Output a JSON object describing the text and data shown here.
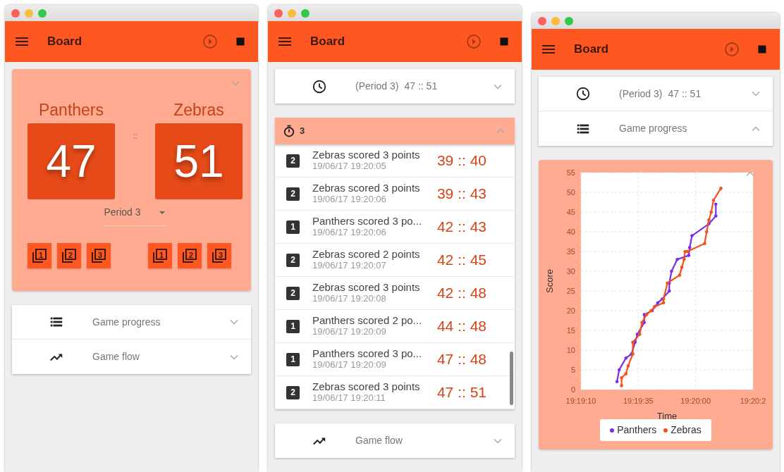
{
  "windows": [
    {
      "toolbar": {
        "title": "Board"
      },
      "blocks": [
        {
          "kind": "scoreboard",
          "expanded": false,
          "separator": "::",
          "period": "Period 3",
          "teams": [
            {
              "name": "Panthers",
              "score": "47",
              "buttons": [
                "1",
                "2",
                "3"
              ]
            },
            {
              "name": "Zebras",
              "score": "51",
              "buttons": [
                "1",
                "2",
                "3"
              ]
            }
          ]
        },
        {
          "kind": "accordion",
          "rows": [
            {
              "kind": "list",
              "label": "Game progress",
              "expanded": false
            },
            {
              "kind": "trend",
              "label": "Game flow",
              "expanded": false
            }
          ]
        }
      ]
    },
    {
      "toolbar": {
        "title": "Board"
      },
      "blocks": [
        {
          "kind": "accordion",
          "rows": [
            {
              "kind": "clock",
              "label": "(Period 3)",
              "score": "47 :: 51",
              "expanded": false
            }
          ]
        },
        {
          "kind": "log",
          "header": "3",
          "expanded": true,
          "entries": [
            {
              "badge": "2",
              "text": "Zebras scored 3 points",
              "time": "19/06/17 19:20:05",
              "score": "39 :: 40"
            },
            {
              "badge": "2",
              "text": "Zebras scored 3 points",
              "time": "19/06/17 19:20:06",
              "score": "39 :: 43"
            },
            {
              "badge": "1",
              "text": "Panthers scored 3 po...",
              "time": "19/06/17 19:20:06",
              "score": "42 :: 43"
            },
            {
              "badge": "2",
              "text": "Zebras scored 2 points",
              "time": "19/06/17 19:20:07",
              "score": "42 :: 45"
            },
            {
              "badge": "2",
              "text": "Zebras scored 3 points",
              "time": "19/06/17 19:20:08",
              "score": "42 :: 48"
            },
            {
              "badge": "1",
              "text": "Panthers scored 2 po...",
              "time": "19/06/17 19:20:09",
              "score": "44 :: 48"
            },
            {
              "badge": "1",
              "text": "Panthers scored 3 po...",
              "time": "19/06/17 19:20:09",
              "score": "47 :: 48"
            },
            {
              "badge": "2",
              "text": "Zebras scored 3 points",
              "time": "19/06/17 19:20:11",
              "score": "47 :: 51"
            }
          ]
        },
        {
          "kind": "accordion",
          "rows": [
            {
              "kind": "trend",
              "label": "Game flow",
              "expanded": false
            }
          ]
        }
      ]
    },
    {
      "toolbar": {
        "title": "Board"
      },
      "blocks": [
        {
          "kind": "accordion",
          "rows": [
            {
              "kind": "clock",
              "label": "(Period 3)",
              "score": "47 :: 51",
              "expanded": false
            },
            {
              "kind": "list",
              "label": "Game progress",
              "expanded": true
            }
          ]
        },
        {
          "kind": "chart",
          "expanded": true,
          "chart_data": {
            "type": "line",
            "grid": true,
            "xlabel": "Time",
            "ylabel": "Score",
            "xlim": [
              69550,
              69625
            ],
            "ylim": [
              0,
              55
            ],
            "xticks": [
              {
                "value": 69550,
                "label": "19:19:10"
              },
              {
                "value": 69575,
                "label": "19:19:35"
              },
              {
                "value": 69600,
                "label": "19:20:00"
              },
              {
                "value": 69625,
                "label": "19:20:2"
              }
            ],
            "yticks": [
              0,
              5,
              10,
              15,
              20,
              25,
              30,
              35,
              40,
              45,
              50,
              55
            ],
            "series": [
              {
                "name": "Panthers",
                "color": "#7b2ee6",
                "x": [
                  69565.7,
                  69566.7,
                  69569.6,
                  69572,
                  69573.6,
                  69574.6,
                  69577.6,
                  69577.6,
                  69581,
                  69583.5,
                  69585.5,
                  69588.5,
                  69588.5,
                  69589.5,
                  69592,
                  69597,
                  69597.4,
                  69598.4,
                  69605.8,
                  69608.8,
                  69608.8
                ],
                "values": [
                  2,
                  5,
                  8,
                  9,
                  12,
                  14,
                  17,
                  19,
                  20,
                  22,
                  23,
                  25,
                  27,
                  30,
                  33,
                  34,
                  36,
                  39,
                  42,
                  44,
                  47
                ]
              },
              {
                "name": "Zebras",
                "color": "#f4511e",
                "x": [
                  69567.7,
                  69567.7,
                  69569.6,
                  69570.6,
                  69572.6,
                  69572.6,
                  69575.6,
                  69576.6,
                  69578.6,
                  69580.6,
                  69582.1,
                  69586,
                  69586,
                  69587.7,
                  69593,
                  69594,
                  69595,
                  69595.4,
                  69596.4,
                  69603.9,
                  69604.8,
                  69605.8,
                  69606.8,
                  69607.8,
                  69611
                ],
                "values": [
                  1,
                  3,
                  4,
                  6,
                  9,
                  12,
                  14,
                  17,
                  19,
                  20,
                  21,
                  22,
                  23,
                  27,
                  29,
                  31,
                  33,
                  35,
                  35,
                  37,
                  40,
                  43,
                  45,
                  48,
                  51
                ]
              }
            ]
          }
        }
      ]
    }
  ]
}
